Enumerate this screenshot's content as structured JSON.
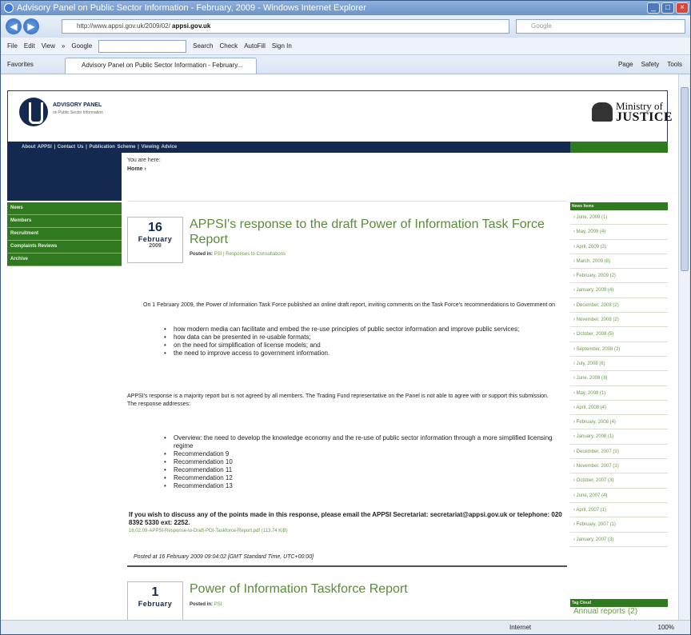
{
  "window": {
    "title": "Advisory Panel on Public Sector Information - February, 2009 - Windows Internet Explorer",
    "address": "http://www.appsi.gov.uk/2009/02/",
    "address_host": "appsi.gov.uk",
    "search_placeholder": "Google"
  },
  "menubar": {
    "items": [
      "File",
      "Edit",
      "View",
      "»",
      "Google"
    ],
    "toolbar_items": [
      "Search",
      "Check",
      "AutoFill",
      "Sign In"
    ]
  },
  "favbar": {
    "favorites": "Favorites",
    "tab": "Advisory Panel on Public Sector Information - February...",
    "tools": [
      "Page",
      "Safety",
      "Tools"
    ]
  },
  "status": {
    "zone": "Internet",
    "zoom": "100%"
  },
  "site": {
    "appsi_name": "ADVISORY PANEL",
    "appsi_sub": "on Public Sector Information",
    "moj_line1": "Ministry of",
    "moj_line2": "JUSTICE",
    "topnav": "About APPSI | Contact Us | Publication Scheme | Viewing Advice",
    "you_are_here": "You are here:",
    "breadcrumb": "Home  ›",
    "left_menu": [
      "News",
      "Members",
      "Recruitment",
      "Complaints Reviews",
      "Archive"
    ]
  },
  "post1": {
    "day": "16",
    "month": "February",
    "year": "2009",
    "title": "APPSI's response to the draft Power of Information Task Force Report",
    "posted_in_label": "Posted in:",
    "posted_in": "PSI | Responses to Consultations",
    "intro": "On 1 February 2009, the Power of Information Task Force published an online draft report, inviting comments on the Task Force's recommendations to Government on",
    "bullets": [
      "how modern media can facilitate and embed the re-use principles of public sector information and improve public services;",
      "how data can be presented in re-usable formats;",
      "on the need for simplification of license models; and",
      "the need to improve access to government information."
    ],
    "para2": "APPSI's response is a majority report but is not agreed by all members. The Trading Fund representative on the Panel is not able to agree with or support this submission.",
    "para2b": "The response addresses:",
    "bullets2": [
      "Overview: the need to develop the knowledge economy and the re-use of public sector information through a more simplified licensing regime",
      "Recommendation 9",
      "Recommendation 10",
      "Recommendation 11",
      "Recommendation 12",
      "Recommendation 13"
    ],
    "contact": "If you wish to discuss any of the points made in this response, please email the APPSI Secretariat: secretariat@appsi.gov.uk or telephone: 020 8392 5330 ext: 2252.",
    "pdf": "16.02.09-APPSI-Response-to-Draft-POI-Taskforce-Report.pdf (113.74 KiB)",
    "posted_at": "Posted at 16 February 2009 09:04:02 [GMT Standard Time, UTC+00:00]"
  },
  "post2": {
    "day": "1",
    "month": "February",
    "title": "Power of Information Taskforce Report",
    "posted_in_label": "Posted in:",
    "posted_in": "PSI"
  },
  "archive": {
    "header": "News Items",
    "items": [
      "June, 2009 (1)",
      "May, 2009 (4)",
      "April, 2009 (3)",
      "March, 2009 (8)",
      "February, 2009 (2)",
      "January, 2009 (4)",
      "December, 2008 (2)",
      "November, 2008 (2)",
      "October, 2008 (5)",
      "September, 2008 (2)",
      "July, 2008 (6)",
      "June, 2008 (3)",
      "May, 2008 (1)",
      "April, 2008 (4)",
      "February, 2008 (4)",
      "January, 2008 (1)",
      "December, 2007 (1)",
      "November, 2007 (1)",
      "October, 2007 (3)",
      "June, 2007 (4)",
      "April, 2007 (1)",
      "February, 2007 (1)",
      "January, 2007 (3)"
    ],
    "tag_header": "Tag Cloud",
    "tag": "Annual reports (2)"
  }
}
